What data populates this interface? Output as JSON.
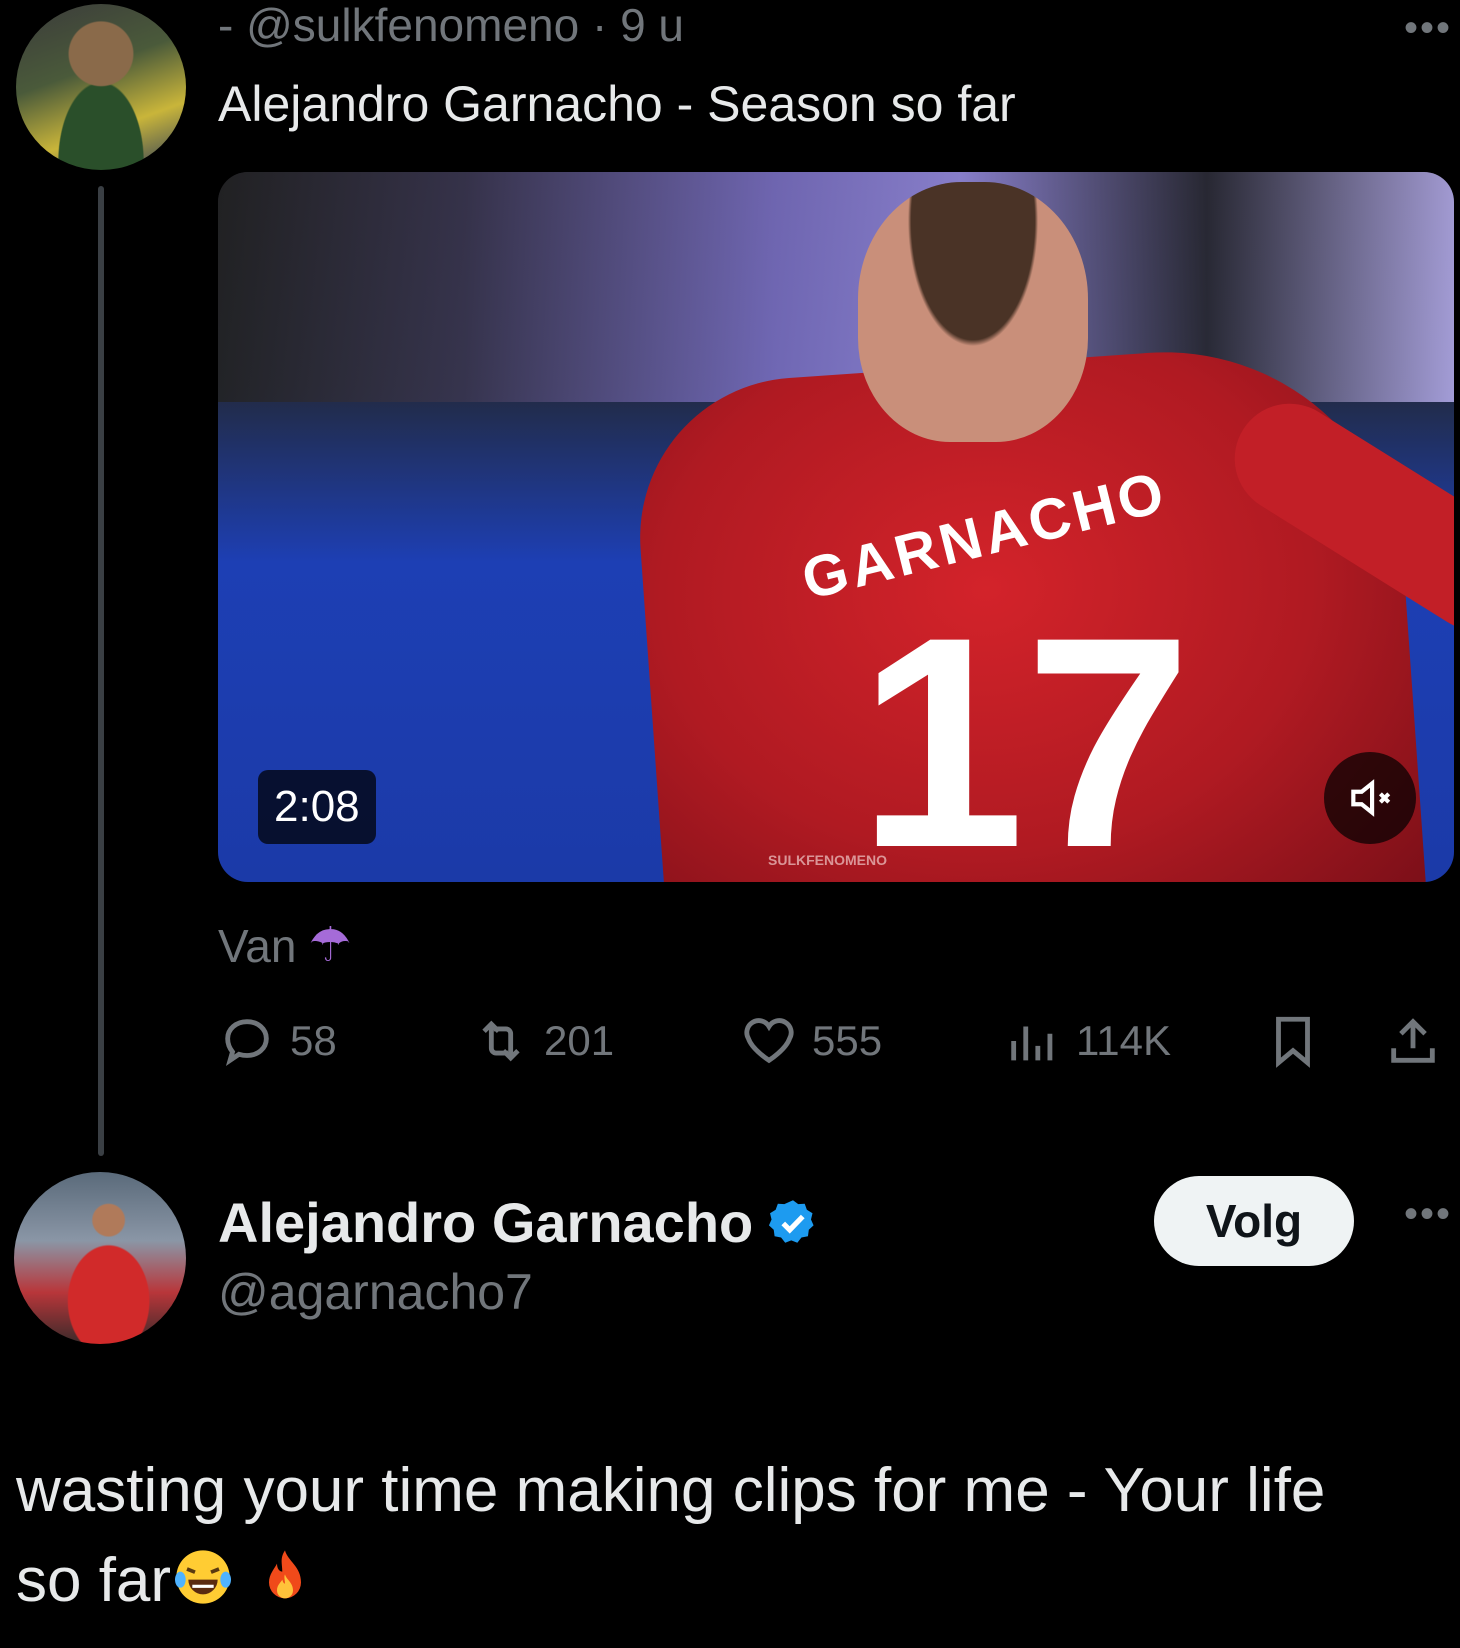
{
  "parent_tweet": {
    "handle_line": "- @sulkfenomeno · 9 u",
    "text": "Alejandro Garnacho - Season so far",
    "video": {
      "duration": "2:08",
      "jersey_name": "GARNACHO",
      "jersey_number": "17",
      "watermark": "SULKFENOMENO"
    },
    "translate_label": "Van",
    "translate_emoji": "☂",
    "stats": {
      "replies": "58",
      "reposts": "201",
      "likes": "555",
      "views": "114K"
    }
  },
  "reply_tweet": {
    "display_name": "Alejandro Garnacho",
    "handle": "@agarnacho7",
    "follow_label": "Volg",
    "text_line1": "wasting your time making clips for me - Your life",
    "text_line2": "so far"
  },
  "more_label": "•••",
  "colors": {
    "background": "#000000",
    "text": "#e7e9ea",
    "muted": "#71767b",
    "verified": "#1d9bf0"
  }
}
